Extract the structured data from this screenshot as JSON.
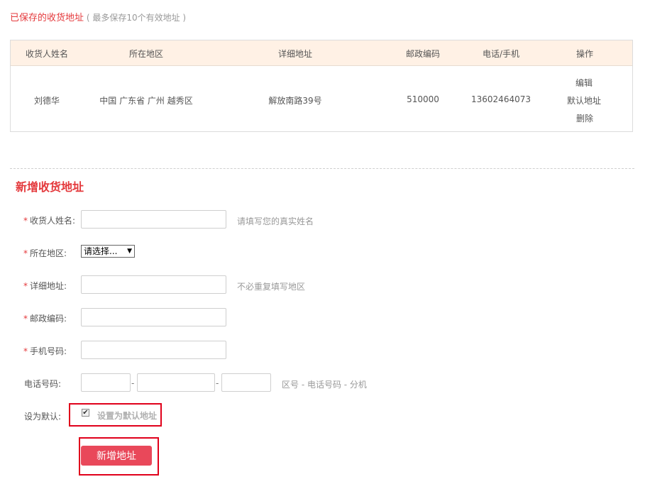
{
  "saved_section": {
    "title": "已保存的收货地址",
    "subtitle": "( 最多保存10个有效地址 )"
  },
  "table": {
    "headers": [
      "收货人姓名",
      "所在地区",
      "详细地址",
      "邮政编码",
      "电话/手机",
      "操作"
    ],
    "rows": [
      {
        "name": "刘德华",
        "region": "中国 广东省 广州 越秀区",
        "address": "解放南路39号",
        "postcode": "510000",
        "phone": "13602464073",
        "actions": {
          "edit": "编辑",
          "default": "默认地址",
          "delete": "删除"
        }
      }
    ]
  },
  "form": {
    "title": "新增收货地址",
    "required_mark": "*",
    "name_label": "收货人姓名:",
    "name_hint": "请填写您的真实姓名",
    "region_label": "所在地区:",
    "region_select": "请选择...",
    "address_label": "详细地址:",
    "address_hint": "不必重复填写地区",
    "postcode_label": "邮政编码:",
    "mobile_label": "手机号码:",
    "tel_label": "电话号码:",
    "tel_separator": "-",
    "tel_hint": "区号 - 电话号码 - 分机",
    "default_label": "设为默认:",
    "default_checkbox_label": "设置为默认地址",
    "default_checked": true,
    "submit_label": "新增地址"
  },
  "colors": {
    "accent": "#e4393c",
    "link": "#0a7ad1",
    "header_bg": "#fff1e5",
    "button_bg": "#e9485a",
    "highlight_box": "#e0001b"
  }
}
